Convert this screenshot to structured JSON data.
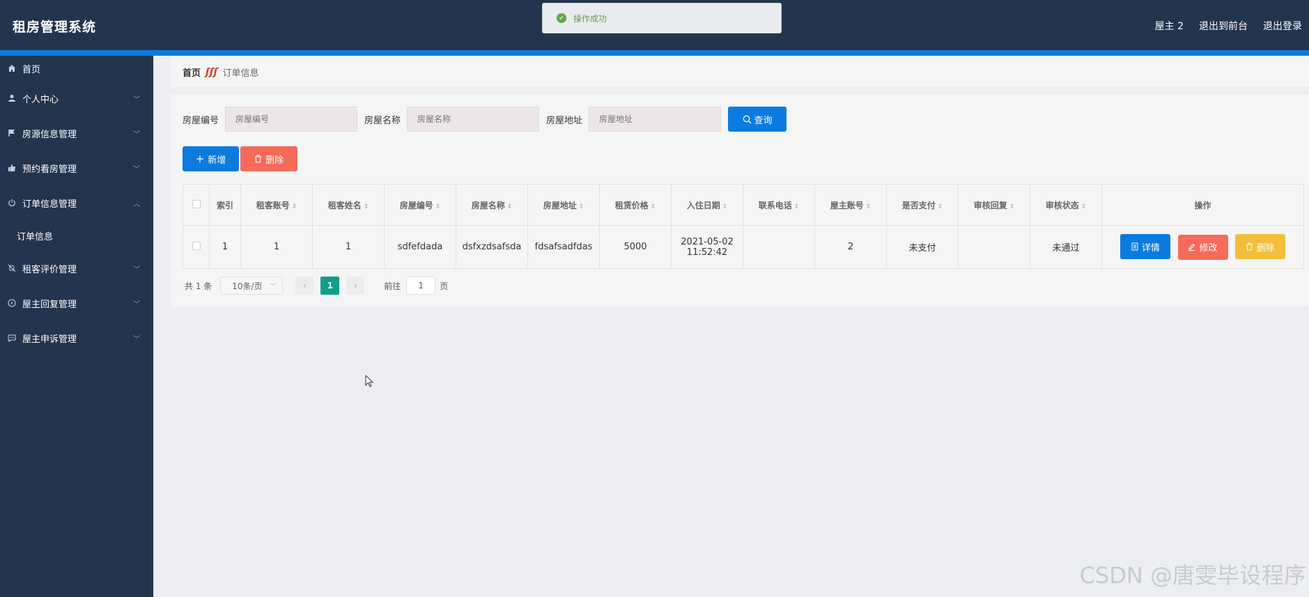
{
  "app": {
    "title": "租房管理系统"
  },
  "header": {
    "user": "屋主 2",
    "front": "退出到前台",
    "logout": "退出登录"
  },
  "toast": {
    "message": "操作成功"
  },
  "sidebar": {
    "items": [
      {
        "label": "首页",
        "icon": "home-icon"
      },
      {
        "label": "个人中心",
        "icon": "user-icon"
      },
      {
        "label": "房源信息管理",
        "icon": "flag-icon"
      },
      {
        "label": "预约看房管理",
        "icon": "thumbs-up-icon"
      },
      {
        "label": "订单信息管理",
        "icon": "power-icon"
      },
      {
        "label": "租客评价管理",
        "icon": "bell-off-icon"
      },
      {
        "label": "屋主回复管理",
        "icon": "compass-icon"
      },
      {
        "label": "屋主申诉管理",
        "icon": "chat-icon"
      }
    ],
    "subitem": "订单信息"
  },
  "breadcrumb": {
    "home": "首页",
    "separator": "ʃʃʃ",
    "current": "订单信息"
  },
  "search": {
    "f1_label": "房屋编号",
    "f1_placeholder": "房屋编号",
    "f2_label": "房屋名称",
    "f2_placeholder": "房屋名称",
    "f3_label": "房屋地址",
    "f3_placeholder": "房屋地址",
    "query": "查询"
  },
  "actions": {
    "add": "新增",
    "delete": "删除"
  },
  "table": {
    "headers": [
      "索引",
      "租客账号",
      "租客姓名",
      "房屋编号",
      "房屋名称",
      "房屋地址",
      "租赁价格",
      "入住日期",
      "联系电话",
      "屋主账号",
      "是否支付",
      "审核回复",
      "审核状态",
      "操作"
    ],
    "row": {
      "index": "1",
      "tenant_account": "1",
      "tenant_name": "1",
      "house_no": "sdfefdada",
      "house_name": "dsfxzdsafsda",
      "house_addr": "fdsafsadfdas",
      "price": "5000",
      "date": "2021-05-02",
      "time": "11:52:42",
      "phone": "",
      "owner_account": "2",
      "paid": "未支付",
      "reply": "",
      "status": "未通过"
    },
    "ops": {
      "detail": "详情",
      "edit": "修改",
      "delete": "删除"
    }
  },
  "pager": {
    "total": "共 1 条",
    "size": "10条/页",
    "page": "1",
    "goto": "前往",
    "goto_value": "1",
    "page_unit": "页"
  },
  "watermark": "CSDN @唐雯毕设程序"
}
